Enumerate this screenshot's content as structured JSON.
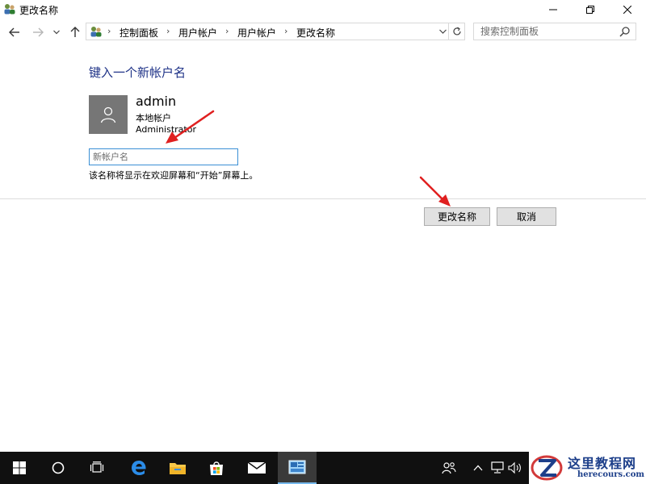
{
  "window": {
    "title": "更改名称",
    "icons": {
      "app": "users-control-panel-icon",
      "minimize": "minimize-icon",
      "maximize": "restore-icon",
      "close": "close-icon"
    }
  },
  "nav": {
    "breadcrumbs": [
      "控制面板",
      "用户帐户",
      "用户帐户",
      "更改名称"
    ],
    "search_placeholder": "搜索控制面板"
  },
  "content": {
    "heading": "键入一个新帐户名",
    "user": {
      "name": "admin",
      "account_type": "本地帐户",
      "role": "Administrator"
    },
    "new_name_placeholder": "新帐户名",
    "new_name_value": "",
    "hint": "该名称将显示在欢迎屏幕和“开始”屏幕上。",
    "rename_button": "更改名称",
    "cancel_button": "取消"
  },
  "colors": {
    "heading": "#1e3287",
    "input_border": "#3a8fd5",
    "annotation_arrow": "#e02020",
    "taskbar": "#101010",
    "accent": "#0078d7"
  },
  "taskbar": {
    "items": [
      "windows-start-icon",
      "cortana-icon",
      "task-view-icon",
      "edge-icon",
      "file-explorer-icon",
      "store-icon",
      "mail-icon",
      "control-panel-icon"
    ],
    "tray": [
      "people-icon",
      "chevron-up-icon",
      "network-icon",
      "volume-icon"
    ]
  },
  "watermark": {
    "title": "这里教程网",
    "url": "herecours.com"
  }
}
